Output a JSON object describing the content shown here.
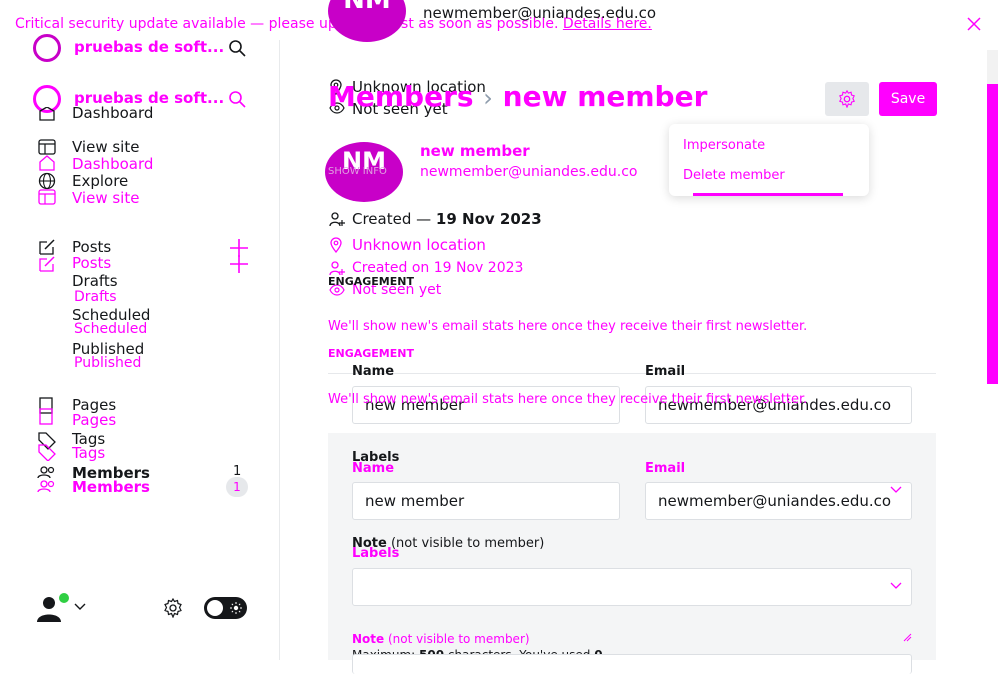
{
  "banner": {
    "text": "Critical security update available — please update Ghost as soon as possible.",
    "link": "Details here."
  },
  "header_overlay": {
    "avatar_initials": "NM",
    "email": "newmember@uniandes.edu.co",
    "location": "Unknown location",
    "seen": "Not seen yet"
  },
  "sidebar": {
    "site_title": "pruebas de soft...",
    "site_title_ghost": "pruebas de soft...",
    "nav_top": [
      {
        "label": "Dashboard"
      },
      {
        "label": "View site"
      },
      {
        "label": "Dashboard"
      },
      {
        "label": "Explore"
      },
      {
        "label": "View site"
      }
    ],
    "posts": "Posts",
    "posts_ghost": "Posts",
    "drafts": "Drafts",
    "drafts_ghost": "Drafts",
    "scheduled": "Scheduled",
    "scheduled_ghost": "Scheduled",
    "published": "Published",
    "published_ghost": "Published",
    "pages": "Pages",
    "pages_ghost": "Pages",
    "tags": "Tags",
    "tags_ghost": "Tags",
    "members": "Members",
    "members_ghost": "Members",
    "members_count": "1",
    "members_count_ghost": "1"
  },
  "breadcrumb": {
    "parent": "Members",
    "sep": "›",
    "current": "new member"
  },
  "actions": {
    "save": "Save",
    "menu": [
      "Impersonate",
      "Delete member"
    ]
  },
  "member": {
    "initials": "NM",
    "initials_sub": "SHOW INFO",
    "name": "new member",
    "email": "newmember@uniandes.edu.co",
    "created_label": "Created —",
    "created_date": "19 Nov 2023",
    "location": "Unknown location",
    "created_on": "Created on 19 Nov 2023",
    "seen": "Not seen yet"
  },
  "engagement": {
    "heading": "ENGAGEMENT",
    "text": "We'll show new's email stats here once they receive their first newsletter.",
    "heading_ghost": "ENGAGEMENT",
    "text_ghost": "We'll show new's email stats here once they receive their first newsletter."
  },
  "form": {
    "name_label": "Name",
    "email_label": "Email",
    "name_value": "new member",
    "email_value": "newmember@uniandes.edu.co",
    "labels_label": "Labels",
    "name_label_ghost": "Name",
    "email_label_ghost": "Email",
    "name_value_ghost": "new member",
    "email_value_ghost": "newmember@uniandes.edu.co",
    "labels_label_ghost": "Labels",
    "note_label": "Note",
    "note_hint": "(not visible to member)",
    "note_label_ghost": "Note",
    "note_hint_ghost": "(not visible to member)",
    "note_max_prefix": "Maximum:",
    "note_max": "500",
    "note_max_suffix": "characters. You've used",
    "note_used": "0"
  },
  "colors": {
    "accent": "#ff00ff",
    "avatar": "#c800c8"
  }
}
